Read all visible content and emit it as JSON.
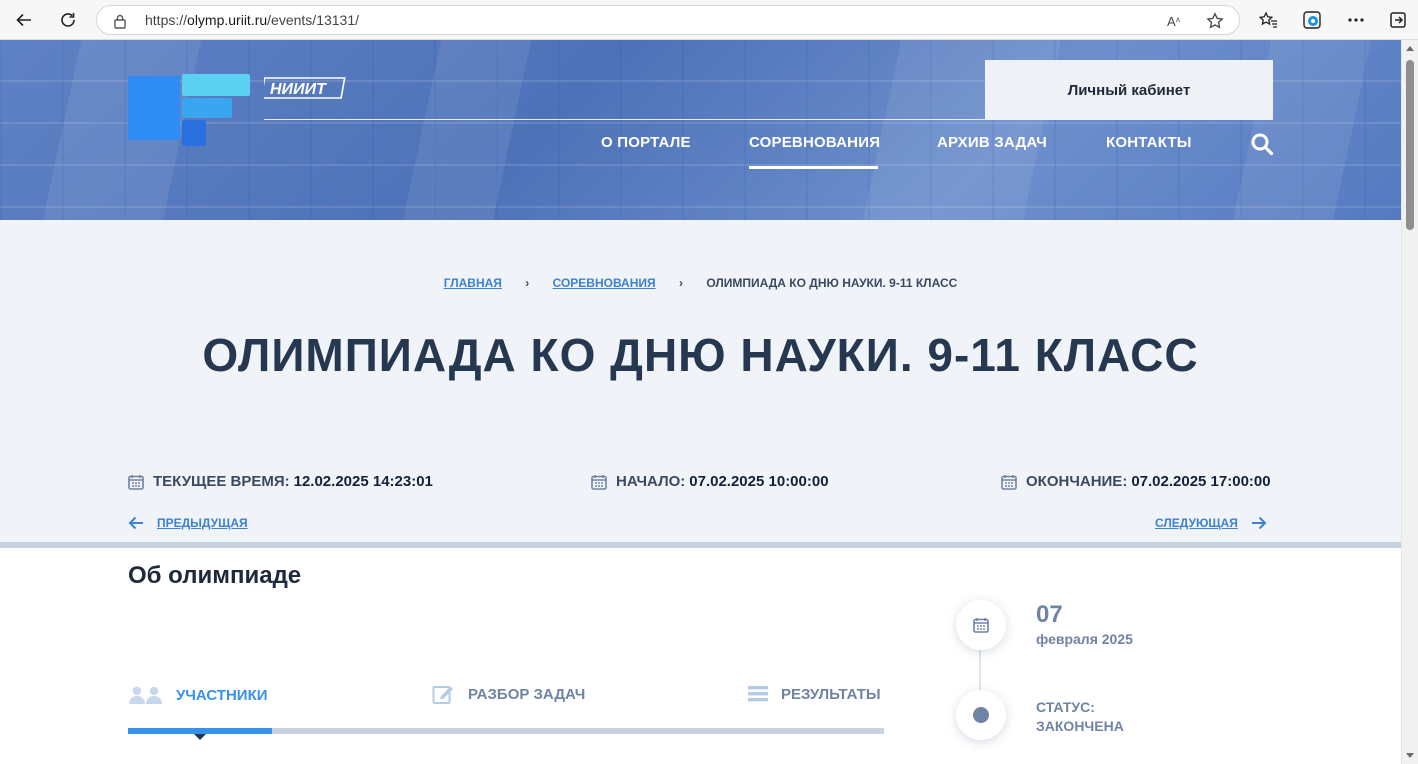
{
  "browser": {
    "url_prefix": "https://",
    "url_host": "olymp.uriit.ru",
    "url_path": "/events/13131/",
    "read_aloud": "Aͅ"
  },
  "header": {
    "logo_text": "НИИИТ",
    "cabinet_label": "Личный кабинет",
    "menu": [
      {
        "label": "О ПОРТАЛЕ"
      },
      {
        "label": "СОРЕВНОВАНИЯ",
        "active": true
      },
      {
        "label": "АРХИВ ЗАДАЧ"
      },
      {
        "label": "КОНТАКТЫ"
      }
    ]
  },
  "breadcrumb": {
    "home": "ГЛАВНАЯ",
    "section": "СОРЕВНОВАНИЯ",
    "current": "ОЛИМПИАДА КО ДНЮ НАУКИ. 9-11 КЛАСС",
    "separator": "›"
  },
  "event": {
    "title": "ОЛИМПИАДА КО ДНЮ НАУКИ. 9-11 КЛАСС",
    "current_time_label": "ТЕКУЩЕЕ ВРЕМЯ:",
    "current_time": "12.02.2025 14:23:01",
    "start_label": "НАЧАЛО:",
    "start": "07.02.2025 10:00:00",
    "end_label": "ОКОНЧАНИЕ:",
    "end": "07.02.2025 17:00:00",
    "prev_label": "ПРЕДЫДУЩАЯ",
    "next_label": "СЛЕДУЮЩАЯ"
  },
  "about": {
    "title": "Об олимпиаде",
    "tabs": [
      {
        "label": "УЧАСТНИКИ",
        "icon": "users-icon",
        "active": true
      },
      {
        "label": "РАЗБОР ЗАДАЧ",
        "icon": "edit-icon"
      },
      {
        "label": "РЕЗУЛЬТАТЫ",
        "icon": "list-icon"
      }
    ]
  },
  "sidebar": {
    "day": "07",
    "month_year": "февраля 2025",
    "status_label": "СТАТУС:",
    "status_value": "ЗАКОНЧЕНА"
  },
  "colors": {
    "accent": "#3592ec",
    "title": "#263750",
    "muted": "#6f84a4",
    "info_bg": "#f0f3f7"
  }
}
